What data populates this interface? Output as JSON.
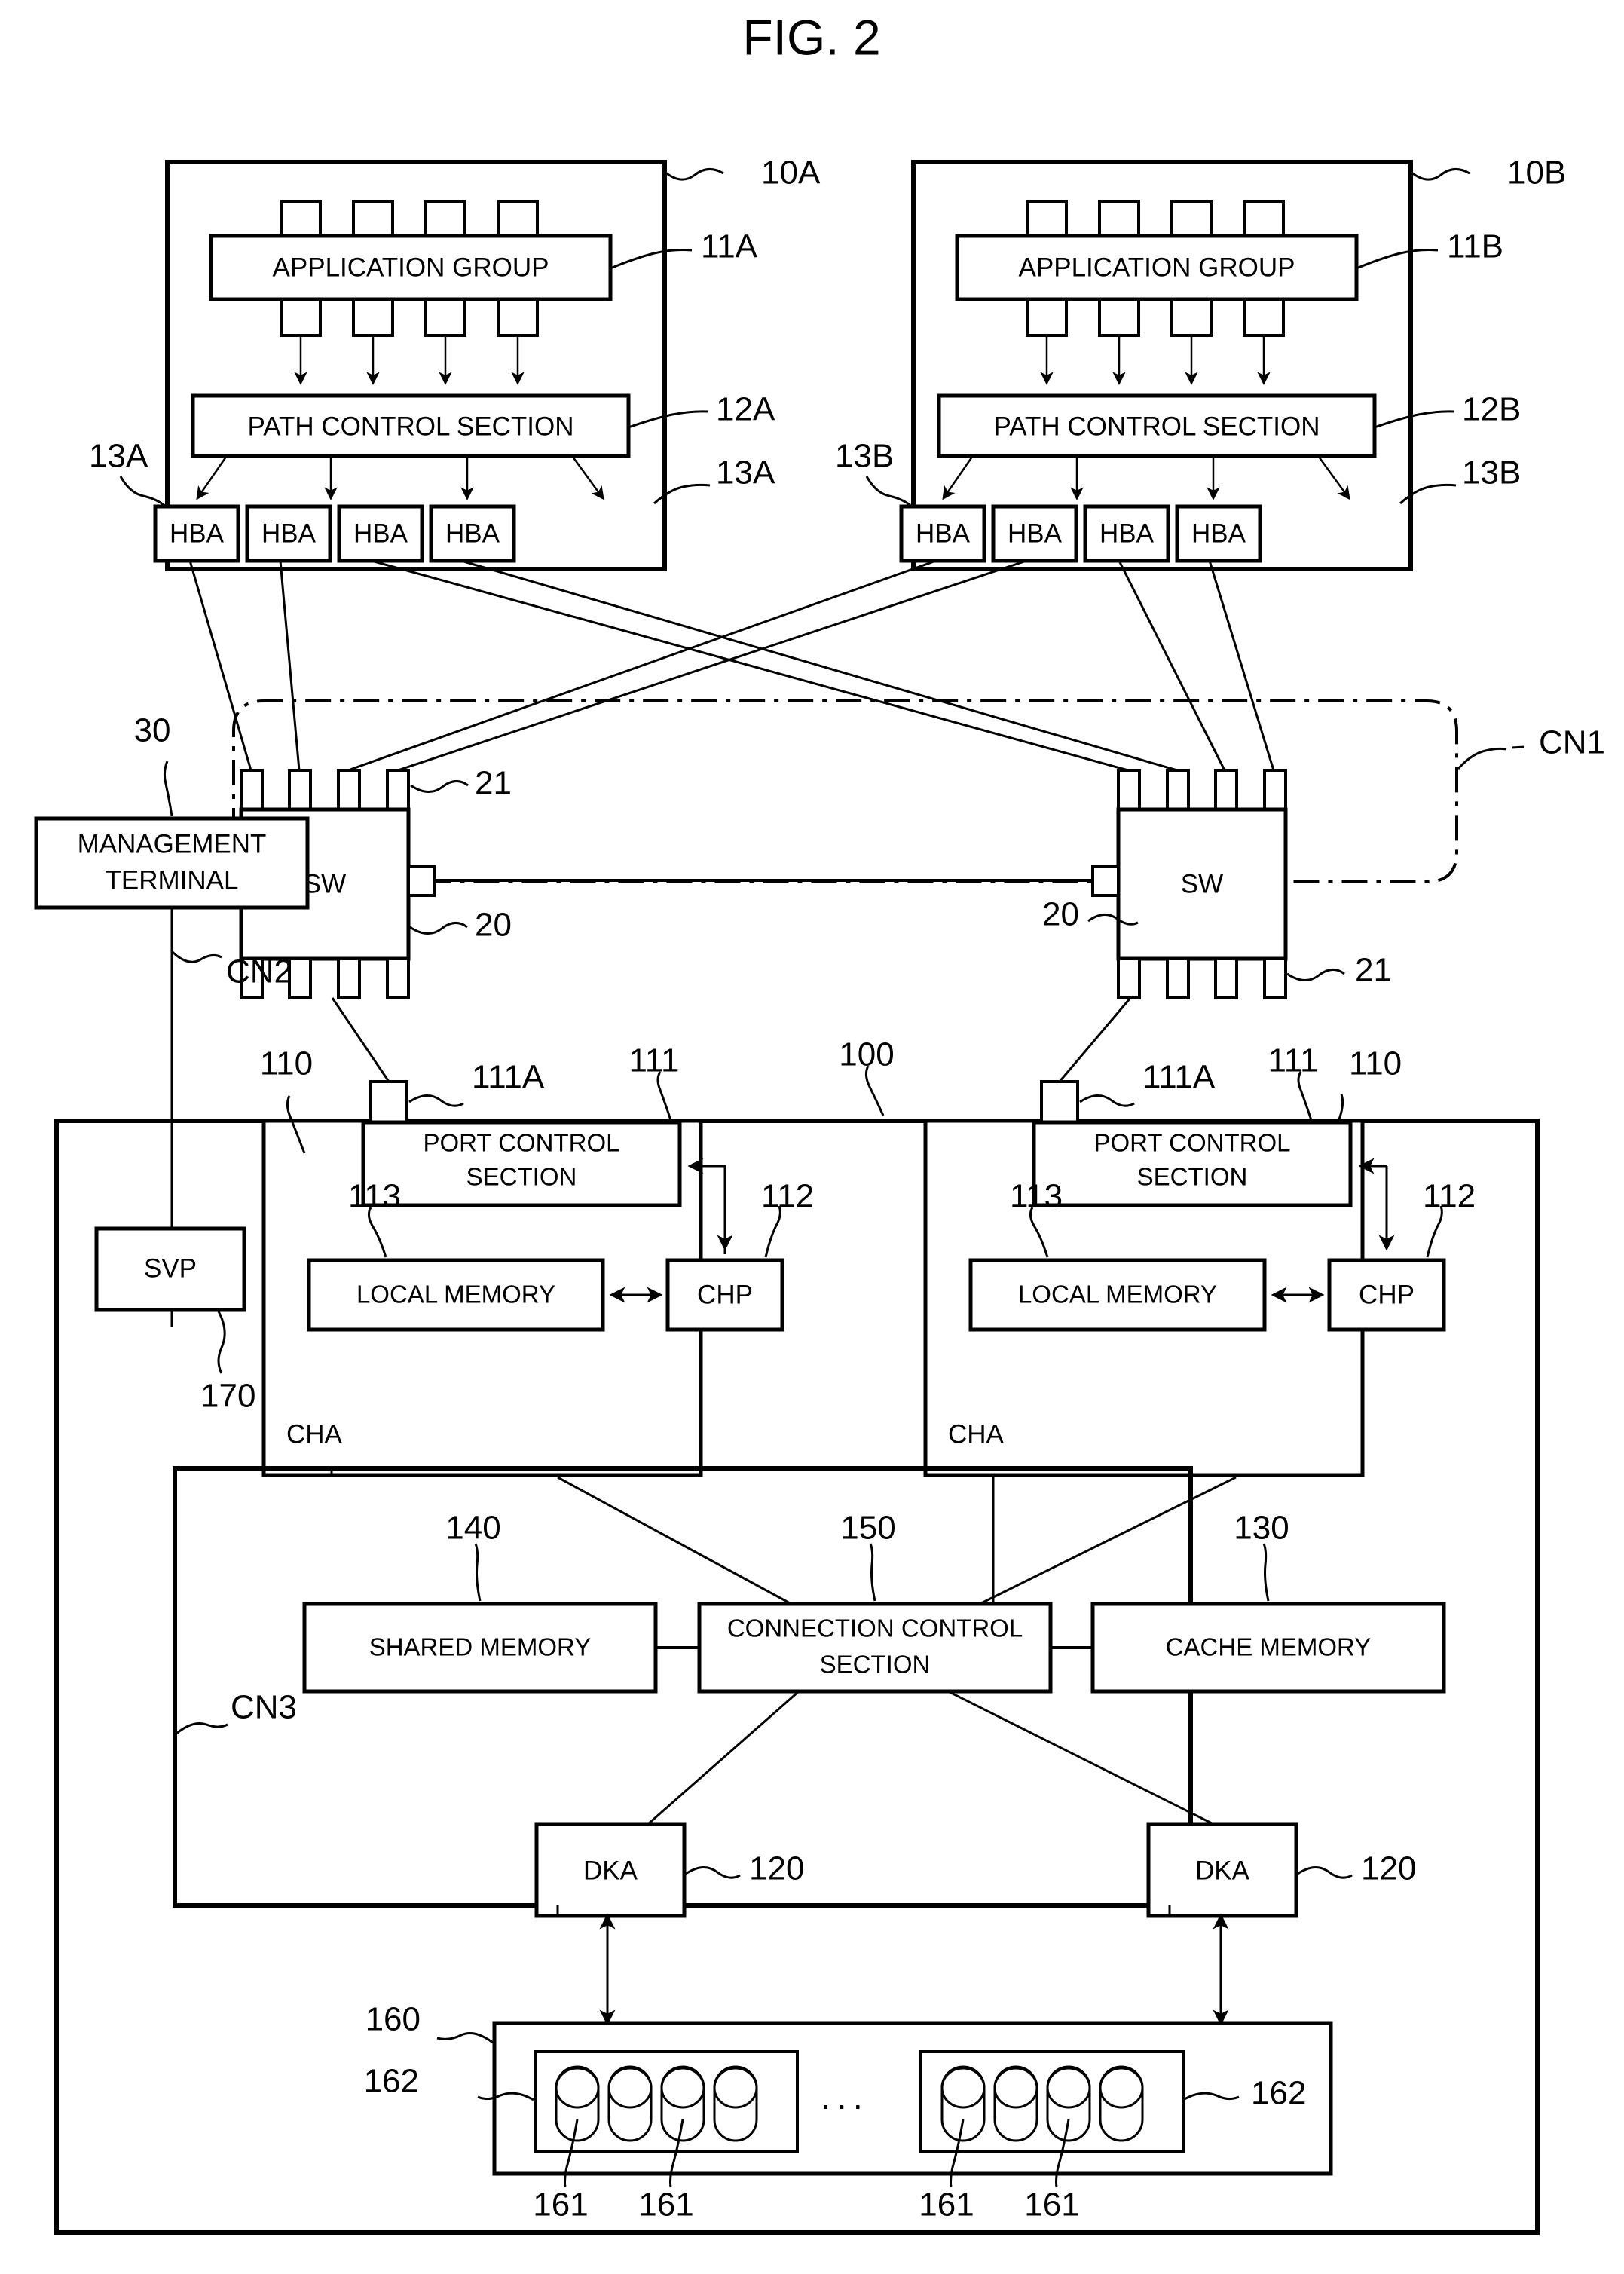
{
  "figure": {
    "title": "FIG. 2"
  },
  "hosts": [
    {
      "ref": "10A",
      "application_group": "APPLICATION GROUP",
      "application_group_ref": "11A",
      "path_control": "PATH CONTROL SECTION",
      "path_control_ref": "12A",
      "hba_label": "HBA",
      "hba_ref_left": "13A",
      "hba_ref_right": "13A",
      "hba_count": 4,
      "app_tab_count": 4
    },
    {
      "ref": "10B",
      "application_group": "APPLICATION GROUP",
      "application_group_ref": "11B",
      "path_control": "PATH CONTROL SECTION",
      "path_control_ref": "12B",
      "hba_label": "HBA",
      "hba_ref_left": "13B",
      "hba_ref_right": "13B",
      "hba_count": 4,
      "app_tab_count": 4
    }
  ],
  "network": {
    "cn1_label": "CN1",
    "cn2_label": "CN2",
    "cn3_label": "CN3",
    "switches": [
      {
        "label": "SW",
        "body_ref": "20",
        "port_ref": "21"
      },
      {
        "label": "SW",
        "body_ref": "20",
        "port_ref": "21"
      }
    ]
  },
  "management_terminal": {
    "line1": "MANAGEMENT",
    "line2": "TERMINAL",
    "ref": "30"
  },
  "storage": {
    "ref": "100",
    "svp": {
      "label": "SVP",
      "ref": "170"
    },
    "channel_adapters": [
      {
        "ref": "110",
        "cha_label": "CHA",
        "port": {
          "ref": "111A"
        },
        "port_control": {
          "line1": "PORT CONTROL",
          "line2": "SECTION",
          "ref": "111"
        },
        "local_memory": {
          "label": "LOCAL MEMORY",
          "ref": "113"
        },
        "chp": {
          "label": "CHP",
          "ref": "112"
        }
      },
      {
        "ref": "110",
        "cha_label": "CHA",
        "port": {
          "ref": "111A"
        },
        "port_control": {
          "line1": "PORT CONTROL",
          "line2": "SECTION",
          "ref": "111"
        },
        "local_memory": {
          "label": "LOCAL MEMORY",
          "ref": "113"
        },
        "chp": {
          "label": "CHP",
          "ref": "112"
        }
      }
    ],
    "shared_memory": {
      "label": "SHARED MEMORY",
      "ref": "140"
    },
    "connection_control": {
      "line1": "CONNECTION CONTROL",
      "line2": "SECTION",
      "ref": "150"
    },
    "cache_memory": {
      "label": "CACHE MEMORY",
      "ref": "130"
    },
    "disk_adapters": [
      {
        "label": "DKA",
        "ref": "120"
      },
      {
        "label": "DKA",
        "ref": "120"
      }
    ],
    "disk_unit": {
      "ref": "160",
      "group_ref_left": "162",
      "group_ref_right": "162",
      "ellipsis": "···",
      "disk_refs": [
        "161",
        "161",
        "161",
        "161"
      ],
      "groups": [
        {
          "disk_count": 4
        },
        {
          "disk_count": 4
        }
      ]
    }
  },
  "colors": {
    "ink": "#000000",
    "paper": "#ffffff"
  }
}
